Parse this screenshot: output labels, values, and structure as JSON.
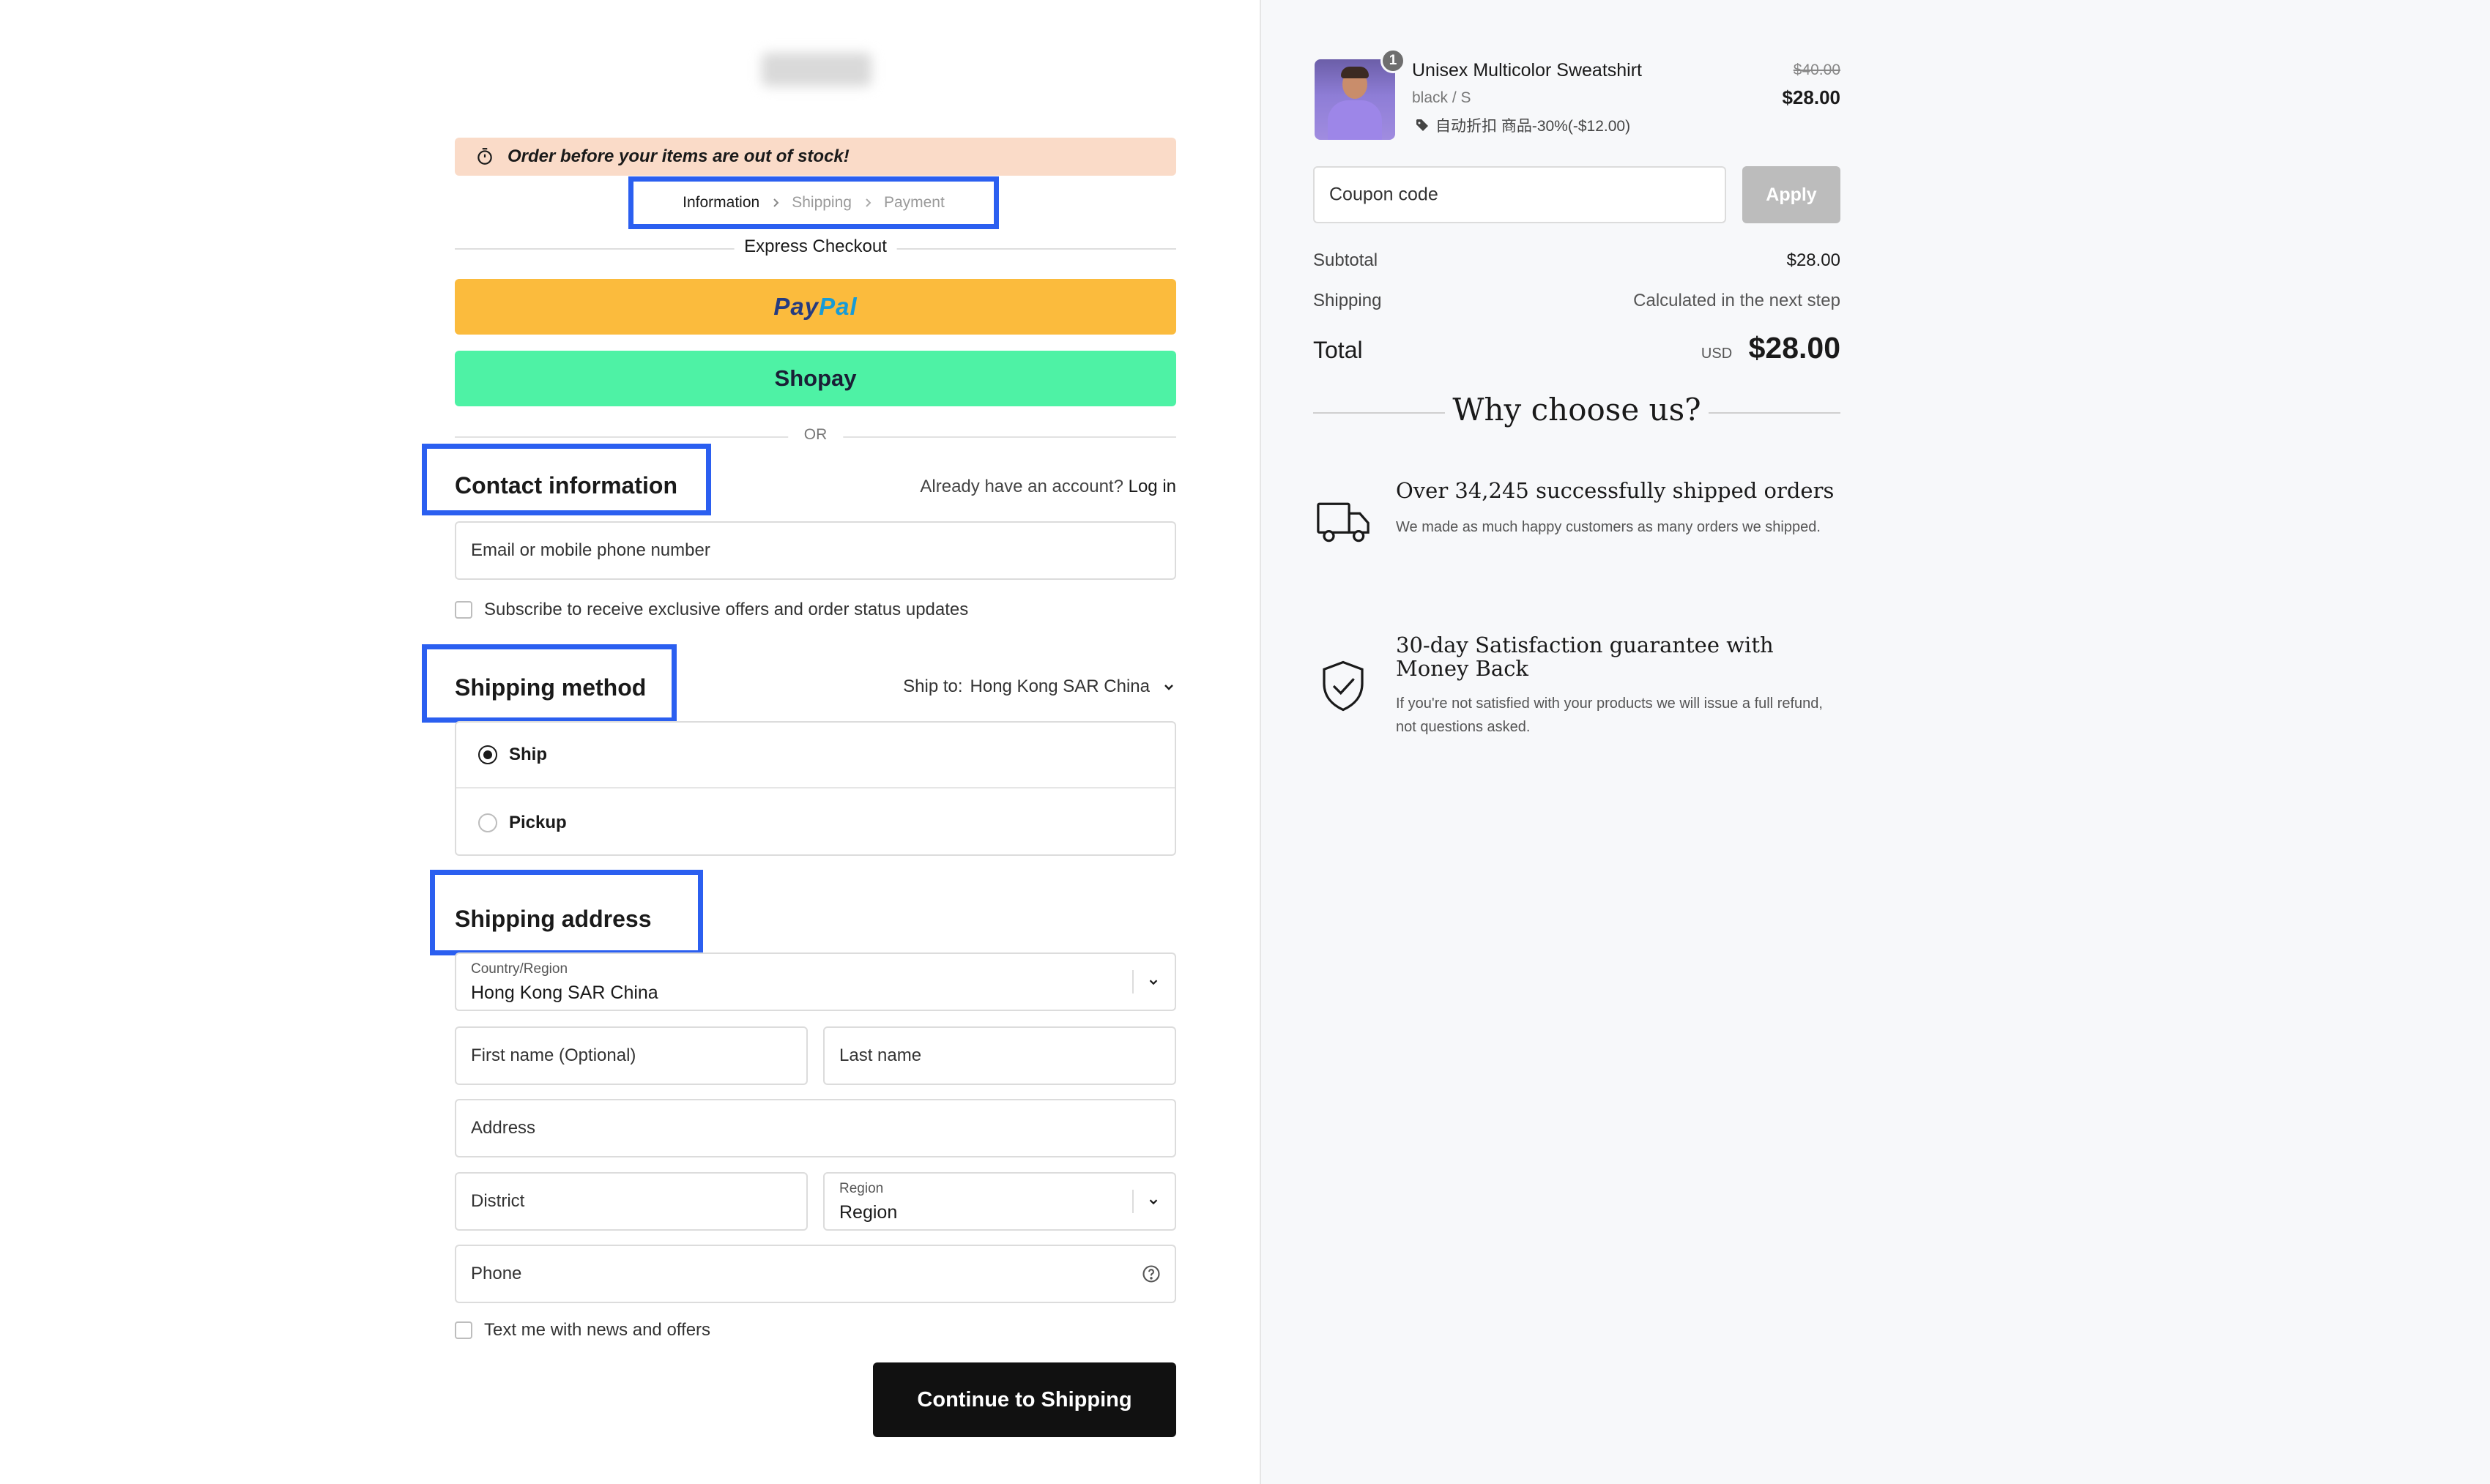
{
  "banner": {
    "text": "Order before your items are out of stock!"
  },
  "breadcrumb": {
    "information": "Information",
    "shipping": "Shipping",
    "payment": "Payment"
  },
  "express": {
    "label": "Express Checkout",
    "paypal_a": "Pay",
    "paypal_b": "Pal",
    "shoppay": "Shopay",
    "or": "OR"
  },
  "contact": {
    "title": "Contact information",
    "account_prompt": "Already have an account?",
    "login": "Log in",
    "email_placeholder": "Email or mobile phone number",
    "subscribe": "Subscribe to receive exclusive offers and order status updates"
  },
  "shipping_method": {
    "title": "Shipping method",
    "ship_to_label": "Ship to:",
    "ship_to_value": "Hong Kong SAR China",
    "options": [
      "Ship",
      "Pickup"
    ]
  },
  "shipping_address": {
    "title": "Shipping address",
    "country_label": "Country/Region",
    "country_value": "Hong Kong SAR China",
    "first_name": "First name (Optional)",
    "last_name": "Last name",
    "address": "Address",
    "district": "District",
    "region_label": "Region",
    "region_value": "Region",
    "phone": "Phone",
    "text_me": "Text me with news and offers"
  },
  "continue_button": "Continue to Shipping",
  "cart": {
    "qty": "1",
    "product_name": "Unisex Multicolor Sweatshirt",
    "variant": "black / S",
    "discount": "自动折扣 商品-30%(-$12.00)",
    "price_old": "$40.00",
    "price_new": "$28.00"
  },
  "coupon": {
    "placeholder": "Coupon code",
    "apply": "Apply"
  },
  "summary": {
    "subtotal_label": "Subtotal",
    "subtotal_value": "$28.00",
    "shipping_label": "Shipping",
    "shipping_value": "Calculated in the next step",
    "total_label": "Total",
    "currency": "USD",
    "total_value": "$28.00"
  },
  "why": {
    "title": "Why choose us?",
    "features": [
      {
        "icon": "truck-icon",
        "title": "Over 34,245 successfully shipped orders",
        "desc": "We made as much happy customers as many orders we shipped."
      },
      {
        "icon": "shield-check-icon",
        "title": "30-day Satisfaction guarantee with Money Back",
        "desc": "If you're not satisfied with your products we will issue a full refund, not questions asked."
      }
    ]
  },
  "colors": {
    "highlight": "#2b5ff0",
    "banner_bg": "#fadbc8",
    "paypal_bg": "#fbbb3d",
    "shoppay_bg": "#4ef2a5",
    "continue_bg": "#111111",
    "apply_bg": "#bcbcbc"
  }
}
